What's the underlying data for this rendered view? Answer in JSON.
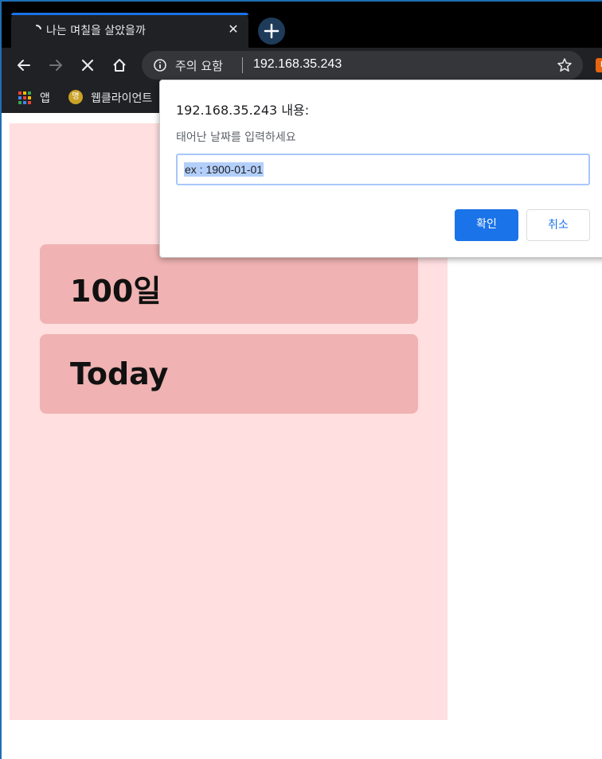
{
  "browser": {
    "tab": {
      "title": "나는 며칠을 살았을까",
      "close_glyph": "✕"
    },
    "new_tab_glyph": "+",
    "omnibox": {
      "security_label": "주의 요함",
      "url": "192.168.35.243"
    },
    "bookmarks": [
      {
        "label": "앱",
        "icon": "apps-grid-icon"
      },
      {
        "label": "웹클라이언트",
        "icon": "bookmark-favicon",
        "favicon_text": "명"
      }
    ],
    "extension_icon_text": "E"
  },
  "page": {
    "cards": [
      {
        "text": "100일"
      },
      {
        "text": "Today"
      }
    ]
  },
  "dialog": {
    "title": "192.168.35.243 내용:",
    "message": "태어난 날짜를 입력하세요",
    "input_value": "ex : 1900-01-01",
    "ok_label": "확인",
    "cancel_label": "취소"
  },
  "colors": {
    "page_panel": "#ffdfe0",
    "card": "#f0b2b2",
    "primary_button": "#1a73e8",
    "chrome_dark": "#202124"
  }
}
